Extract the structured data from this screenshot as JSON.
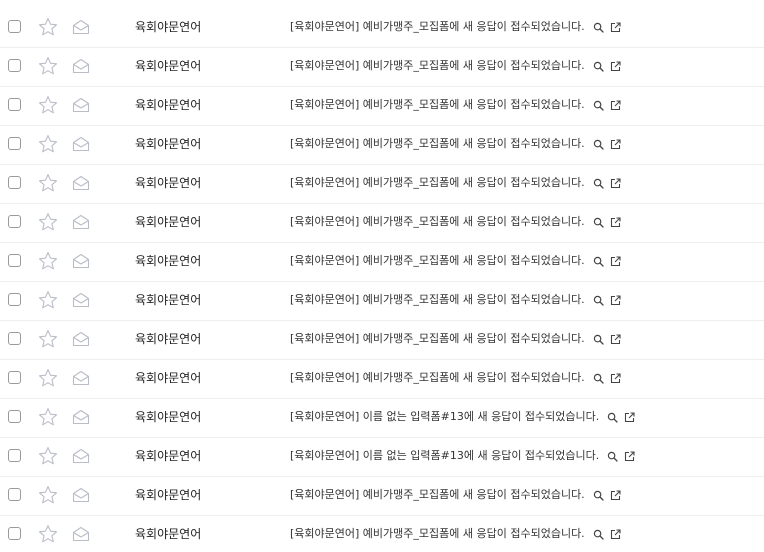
{
  "icons": {
    "checkbox": "checkbox-icon",
    "star": "star-icon",
    "envelope": "envelope-icon",
    "search": "search-icon",
    "open": "open-new-window-icon"
  },
  "colors": {
    "icon_gray": "#b9bdc7",
    "row_border": "#eeeeee",
    "text": "#222222"
  },
  "mails": [
    {
      "sender": "육회야문연어",
      "subject": "[육회야문연어] 예비가맹주_모집폼에 새 응답이 접수되었습니다."
    },
    {
      "sender": "육회야문연어",
      "subject": "[육회야문연어] 예비가맹주_모집폼에 새 응답이 접수되었습니다."
    },
    {
      "sender": "육회야문연어",
      "subject": "[육회야문연어] 예비가맹주_모집폼에 새 응답이 접수되었습니다."
    },
    {
      "sender": "육회야문연어",
      "subject": "[육회야문연어] 예비가맹주_모집폼에 새 응답이 접수되었습니다."
    },
    {
      "sender": "육회야문연어",
      "subject": "[육회야문연어] 예비가맹주_모집폼에 새 응답이 접수되었습니다."
    },
    {
      "sender": "육회야문연어",
      "subject": "[육회야문연어] 예비가맹주_모집폼에 새 응답이 접수되었습니다."
    },
    {
      "sender": "육회야문연어",
      "subject": "[육회야문연어] 예비가맹주_모집폼에 새 응답이 접수되었습니다."
    },
    {
      "sender": "육회야문연어",
      "subject": "[육회야문연어] 예비가맹주_모집폼에 새 응답이 접수되었습니다."
    },
    {
      "sender": "육회야문연어",
      "subject": "[육회야문연어] 예비가맹주_모집폼에 새 응답이 접수되었습니다."
    },
    {
      "sender": "육회야문연어",
      "subject": "[육회야문연어] 예비가맹주_모집폼에 새 응답이 접수되었습니다."
    },
    {
      "sender": "육회야문연어",
      "subject": "[육회야문연어] 이름 없는 입력폼#13에 새 응답이 접수되었습니다."
    },
    {
      "sender": "육회야문연어",
      "subject": "[육회야문연어] 이름 없는 입력폼#13에 새 응답이 접수되었습니다."
    },
    {
      "sender": "육회야문연어",
      "subject": "[육회야문연어] 예비가맹주_모집폼에 새 응답이 접수되었습니다."
    },
    {
      "sender": "육회야문연어",
      "subject": "[육회야문연어] 예비가맹주_모집폼에 새 응답이 접수되었습니다."
    }
  ]
}
